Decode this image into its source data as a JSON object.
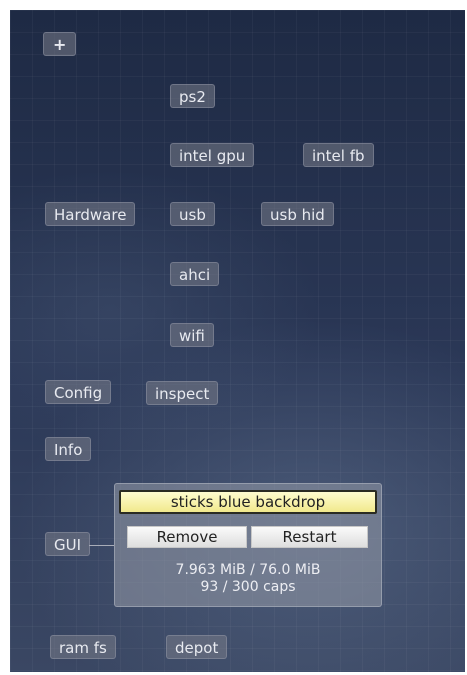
{
  "toolbar": {
    "add_label": "+"
  },
  "components": {
    "ps2": "ps2",
    "intel_gpu": "intel gpu",
    "intel_fb": "intel fb",
    "hardware": "Hardware",
    "usb": "usb",
    "usb_hid": "usb hid",
    "ahci": "ahci",
    "wifi": "wifi",
    "config": "Config",
    "inspect": "inspect",
    "info": "Info",
    "gui": "GUI",
    "ram_fs": "ram fs",
    "depot": "depot"
  },
  "popup": {
    "title": "sticks blue backdrop",
    "remove_label": "Remove",
    "restart_label": "Restart",
    "ram_usage": "7.963 MiB / 76.0 MiB",
    "caps_usage": "93 / 300 caps"
  }
}
